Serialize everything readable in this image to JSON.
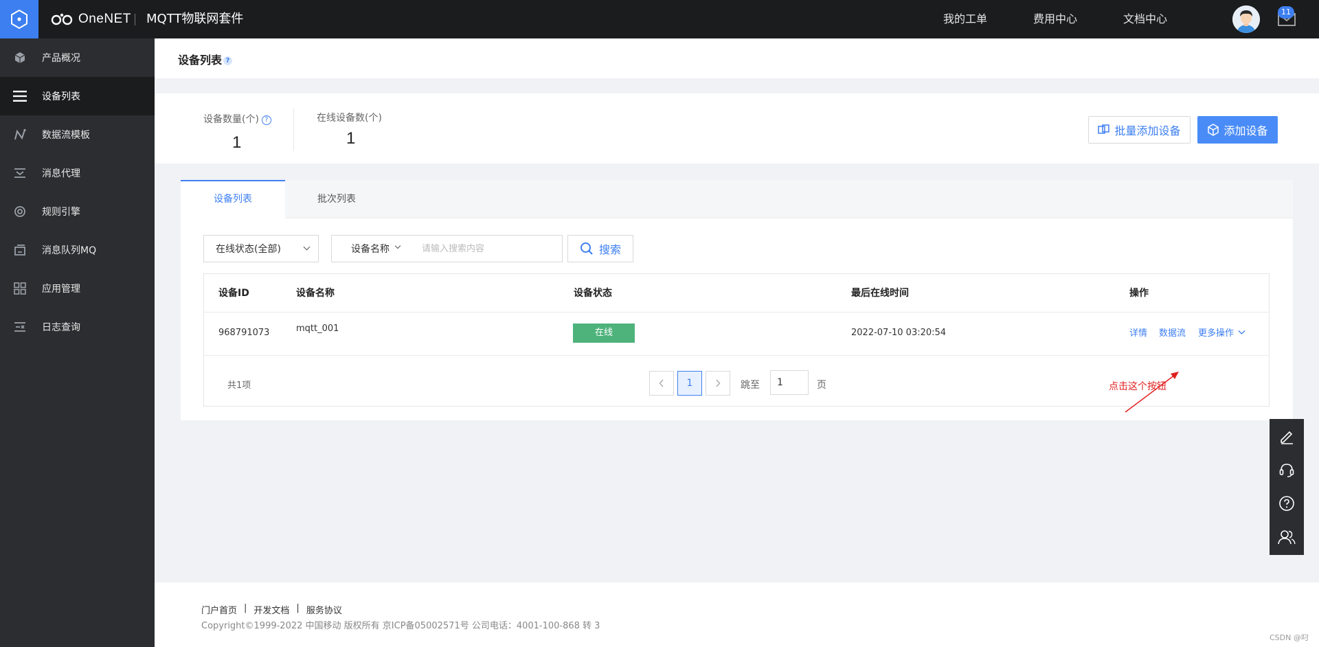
{
  "header": {
    "brand": "OneNET",
    "suite_title": "MQTT物联网套件",
    "nav": [
      "我的工单",
      "费用中心",
      "文档中心"
    ],
    "notification_count": "11"
  },
  "sidebar": {
    "items": [
      {
        "label": "产品概况",
        "icon": "cube-icon"
      },
      {
        "label": "设备列表",
        "icon": "list-icon"
      },
      {
        "label": "数据流模板",
        "icon": "datastream-icon"
      },
      {
        "label": "消息代理",
        "icon": "message-proxy-icon"
      },
      {
        "label": "规则引擎",
        "icon": "rule-engine-icon"
      },
      {
        "label": "消息队列MQ",
        "icon": "queue-icon"
      },
      {
        "label": "应用管理",
        "icon": "grid-icon"
      },
      {
        "label": "日志查询",
        "icon": "log-icon"
      }
    ],
    "active_index": 1
  },
  "page": {
    "title": "设备列表",
    "help_glyph": "?"
  },
  "stats": {
    "device_count_label": "设备数量(个)",
    "device_count": "1",
    "online_count_label": "在线设备数(个)",
    "online_count": "1",
    "batch_add_label": "批量添加设备",
    "add_label": "添加设备"
  },
  "tabs": [
    "设备列表",
    "批次列表"
  ],
  "filters": {
    "status_select": "在线状态(全部)",
    "field_select": "设备名称",
    "search_placeholder": "请输入搜索内容",
    "search_button": "搜索"
  },
  "table": {
    "columns": [
      "设备ID",
      "设备名称",
      "设备状态",
      "最后在线时间",
      "操作"
    ],
    "rows": [
      {
        "id": "968791073",
        "name": "mqtt_001",
        "status": "在线",
        "last_online": "2022-07-10 03:20:54",
        "actions": [
          "详情",
          "数据流",
          "更多操作"
        ]
      }
    ]
  },
  "pagination": {
    "total": "共1项",
    "current_page": "1",
    "jump_label": "跳至",
    "jump_value": "1",
    "page_suffix": "页"
  },
  "annotation": "点击这个按钮",
  "footer": {
    "links": [
      "门户首页",
      "开发文档",
      "服务协议"
    ],
    "copyright": "Copyright©1999-2022 中国移动 版权所有 京ICP备05002571号 公司电话：4001-100-868 转 3"
  },
  "watermark": "CSDN @叼",
  "colors": {
    "accent": "#3d7ff0",
    "online": "#4db37b",
    "topbar": "#1b1c1e",
    "sidebar": "#2c2d30",
    "annotation": "#e02020"
  }
}
